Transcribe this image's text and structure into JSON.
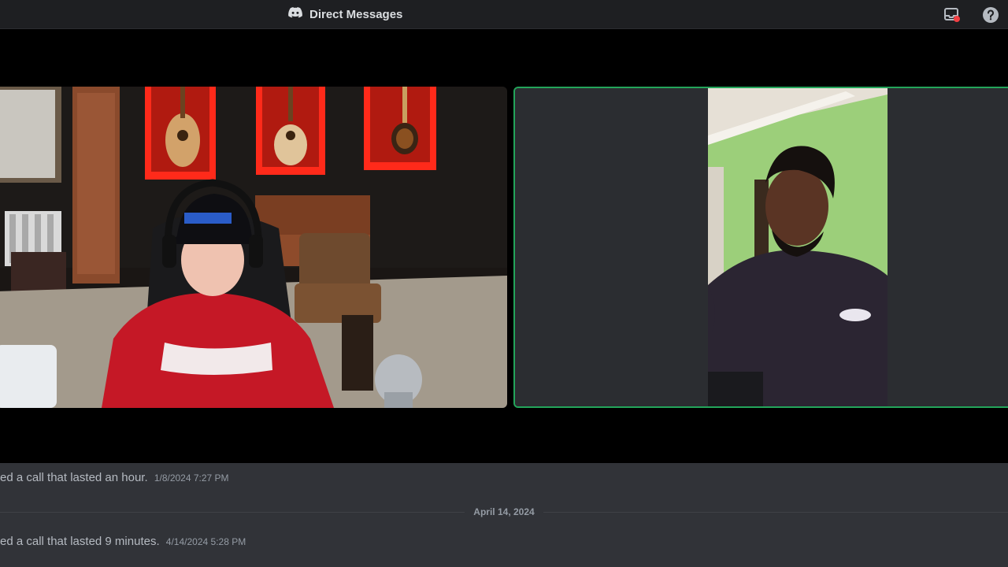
{
  "titlebar": {
    "icon": "discord-logo-icon",
    "title": "Direct Messages",
    "right_icons": [
      "inbox-icon",
      "help-icon"
    ]
  },
  "call": {
    "participants": [
      {
        "id": "participant-left",
        "speaking": false
      },
      {
        "id": "participant-right",
        "speaking": true
      }
    ],
    "speaking_color": "#23a55a"
  },
  "chat": {
    "messages": [
      {
        "text": "ed a call that lasted an hour.",
        "timestamp": "1/8/2024 7:27 PM"
      },
      {
        "text": "ed a call that lasted 9 minutes.",
        "timestamp": "4/14/2024 5:28 PM"
      }
    ],
    "date_divider": "April 14, 2024"
  },
  "colors": {
    "titlebar_bg": "#1e1f22",
    "chat_bg": "#313338",
    "call_bg": "#000000"
  }
}
